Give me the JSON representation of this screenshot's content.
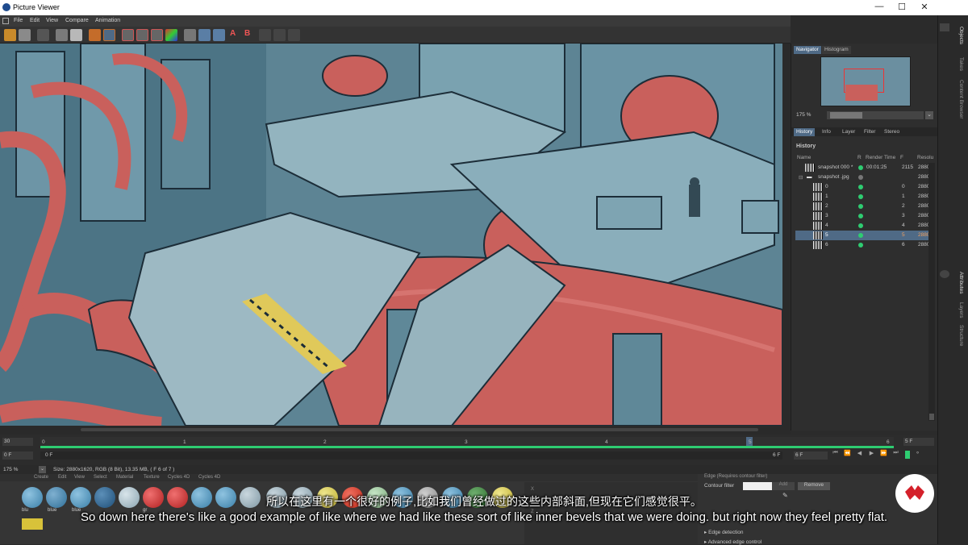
{
  "window": {
    "title": "Picture Viewer",
    "minimize": "—",
    "maximize": "☐",
    "close": "✕"
  },
  "menu": [
    "File",
    "Edit",
    "View",
    "Compare",
    "Animation"
  ],
  "navigator": {
    "tabs": [
      "Navigator",
      "Histogram"
    ],
    "zoom": "175 %"
  },
  "history_panel": {
    "tabs": [
      "History",
      "Info",
      "Layer",
      "Filter",
      "Stereo"
    ],
    "heading": "History",
    "columns": [
      "Name",
      "R",
      "Render Time",
      "F",
      "Resolu"
    ],
    "rows": [
      {
        "name": "snapshot 000 *",
        "time": "00:01:25",
        "frame": "2115",
        "res": "2880"
      },
      {
        "name": "snapshot .jpg",
        "time": "",
        "frame": "",
        "res": "2880"
      },
      {
        "name": "0",
        "time": "",
        "frame": "0",
        "res": "2880"
      },
      {
        "name": "1",
        "time": "",
        "frame": "1",
        "res": "2880"
      },
      {
        "name": "2",
        "time": "",
        "frame": "2",
        "res": "2880"
      },
      {
        "name": "3",
        "time": "",
        "frame": "3",
        "res": "2880"
      },
      {
        "name": "4",
        "time": "",
        "frame": "4",
        "res": "2880"
      },
      {
        "name": "5",
        "time": "",
        "frame": "5",
        "res": "2880"
      },
      {
        "name": "6",
        "time": "",
        "frame": "6",
        "res": "2880"
      }
    ]
  },
  "side_tabs": [
    "Objects",
    "Takes",
    "Content Browser",
    "Attributes",
    "Layers",
    "Structure"
  ],
  "timeline": {
    "fps": "30",
    "ticks": [
      "0",
      "1",
      "2",
      "3",
      "4",
      "5",
      "6"
    ],
    "end_frame": "5 F",
    "start_field": "0 F",
    "current_label": "0 F",
    "right_frame": "6 F",
    "right_frame2": "6 F"
  },
  "statusbar": {
    "zoom": "175 %",
    "info": "Size: 2880x1620, RGB (8 Bit), 13.35 MB,  ( F 6 of 7 )"
  },
  "material_menu": [
    "Create",
    "Edit",
    "View",
    "Select",
    "Material",
    "Texture",
    "Cycles 4D",
    "Cycles 4D"
  ],
  "material_labels": [
    "blu",
    "blue",
    "blue",
    "gr"
  ],
  "attributes": {
    "header": "Edge (Requires contour filter)",
    "contour_label": "Contour filter",
    "add_label": "Add",
    "remove_label": "Remove",
    "items": [
      "Edge detection",
      "Advanced edge control"
    ]
  },
  "subtitles": {
    "chinese": "所以在这里有一个很好的例子,比如我们曾经做过的这些内部斜面,但现在它们感觉很平。",
    "english": "So down here there's like a good example of like where we had like these sort of like inner bevels that we were doing. but right now they feel pretty flat."
  },
  "colors": {
    "accent": "#4f6a86",
    "green": "#2ecc71",
    "pipe_red": "#c9605c",
    "metal_blue": "#7aa2b0",
    "logo_red": "#d4202a"
  }
}
